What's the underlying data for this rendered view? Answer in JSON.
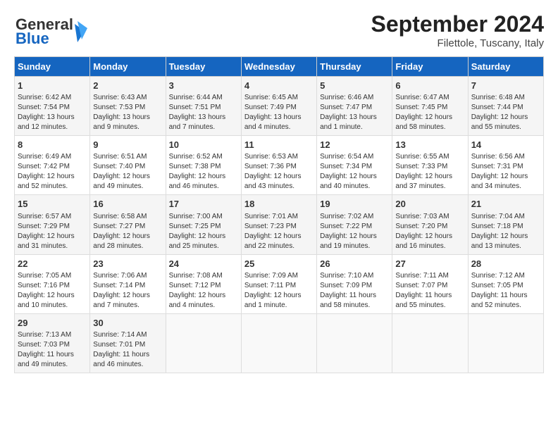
{
  "header": {
    "logo_line1": "General",
    "logo_line2": "Blue",
    "month": "September 2024",
    "location": "Filettole, Tuscany, Italy"
  },
  "days_of_week": [
    "Sunday",
    "Monday",
    "Tuesday",
    "Wednesday",
    "Thursday",
    "Friday",
    "Saturday"
  ],
  "weeks": [
    [
      {
        "day": "1",
        "info": "Sunrise: 6:42 AM\nSunset: 7:54 PM\nDaylight: 13 hours\nand 12 minutes."
      },
      {
        "day": "2",
        "info": "Sunrise: 6:43 AM\nSunset: 7:53 PM\nDaylight: 13 hours\nand 9 minutes."
      },
      {
        "day": "3",
        "info": "Sunrise: 6:44 AM\nSunset: 7:51 PM\nDaylight: 13 hours\nand 7 minutes."
      },
      {
        "day": "4",
        "info": "Sunrise: 6:45 AM\nSunset: 7:49 PM\nDaylight: 13 hours\nand 4 minutes."
      },
      {
        "day": "5",
        "info": "Sunrise: 6:46 AM\nSunset: 7:47 PM\nDaylight: 13 hours\nand 1 minute."
      },
      {
        "day": "6",
        "info": "Sunrise: 6:47 AM\nSunset: 7:45 PM\nDaylight: 12 hours\nand 58 minutes."
      },
      {
        "day": "7",
        "info": "Sunrise: 6:48 AM\nSunset: 7:44 PM\nDaylight: 12 hours\nand 55 minutes."
      }
    ],
    [
      {
        "day": "8",
        "info": "Sunrise: 6:49 AM\nSunset: 7:42 PM\nDaylight: 12 hours\nand 52 minutes."
      },
      {
        "day": "9",
        "info": "Sunrise: 6:51 AM\nSunset: 7:40 PM\nDaylight: 12 hours\nand 49 minutes."
      },
      {
        "day": "10",
        "info": "Sunrise: 6:52 AM\nSunset: 7:38 PM\nDaylight: 12 hours\nand 46 minutes."
      },
      {
        "day": "11",
        "info": "Sunrise: 6:53 AM\nSunset: 7:36 PM\nDaylight: 12 hours\nand 43 minutes."
      },
      {
        "day": "12",
        "info": "Sunrise: 6:54 AM\nSunset: 7:34 PM\nDaylight: 12 hours\nand 40 minutes."
      },
      {
        "day": "13",
        "info": "Sunrise: 6:55 AM\nSunset: 7:33 PM\nDaylight: 12 hours\nand 37 minutes."
      },
      {
        "day": "14",
        "info": "Sunrise: 6:56 AM\nSunset: 7:31 PM\nDaylight: 12 hours\nand 34 minutes."
      }
    ],
    [
      {
        "day": "15",
        "info": "Sunrise: 6:57 AM\nSunset: 7:29 PM\nDaylight: 12 hours\nand 31 minutes."
      },
      {
        "day": "16",
        "info": "Sunrise: 6:58 AM\nSunset: 7:27 PM\nDaylight: 12 hours\nand 28 minutes."
      },
      {
        "day": "17",
        "info": "Sunrise: 7:00 AM\nSunset: 7:25 PM\nDaylight: 12 hours\nand 25 minutes."
      },
      {
        "day": "18",
        "info": "Sunrise: 7:01 AM\nSunset: 7:23 PM\nDaylight: 12 hours\nand 22 minutes."
      },
      {
        "day": "19",
        "info": "Sunrise: 7:02 AM\nSunset: 7:22 PM\nDaylight: 12 hours\nand 19 minutes."
      },
      {
        "day": "20",
        "info": "Sunrise: 7:03 AM\nSunset: 7:20 PM\nDaylight: 12 hours\nand 16 minutes."
      },
      {
        "day": "21",
        "info": "Sunrise: 7:04 AM\nSunset: 7:18 PM\nDaylight: 12 hours\nand 13 minutes."
      }
    ],
    [
      {
        "day": "22",
        "info": "Sunrise: 7:05 AM\nSunset: 7:16 PM\nDaylight: 12 hours\nand 10 minutes."
      },
      {
        "day": "23",
        "info": "Sunrise: 7:06 AM\nSunset: 7:14 PM\nDaylight: 12 hours\nand 7 minutes."
      },
      {
        "day": "24",
        "info": "Sunrise: 7:08 AM\nSunset: 7:12 PM\nDaylight: 12 hours\nand 4 minutes."
      },
      {
        "day": "25",
        "info": "Sunrise: 7:09 AM\nSunset: 7:11 PM\nDaylight: 12 hours\nand 1 minute."
      },
      {
        "day": "26",
        "info": "Sunrise: 7:10 AM\nSunset: 7:09 PM\nDaylight: 11 hours\nand 58 minutes."
      },
      {
        "day": "27",
        "info": "Sunrise: 7:11 AM\nSunset: 7:07 PM\nDaylight: 11 hours\nand 55 minutes."
      },
      {
        "day": "28",
        "info": "Sunrise: 7:12 AM\nSunset: 7:05 PM\nDaylight: 11 hours\nand 52 minutes."
      }
    ],
    [
      {
        "day": "29",
        "info": "Sunrise: 7:13 AM\nSunset: 7:03 PM\nDaylight: 11 hours\nand 49 minutes."
      },
      {
        "day": "30",
        "info": "Sunrise: 7:14 AM\nSunset: 7:01 PM\nDaylight: 11 hours\nand 46 minutes."
      },
      {
        "day": "",
        "info": ""
      },
      {
        "day": "",
        "info": ""
      },
      {
        "day": "",
        "info": ""
      },
      {
        "day": "",
        "info": ""
      },
      {
        "day": "",
        "info": ""
      }
    ]
  ]
}
